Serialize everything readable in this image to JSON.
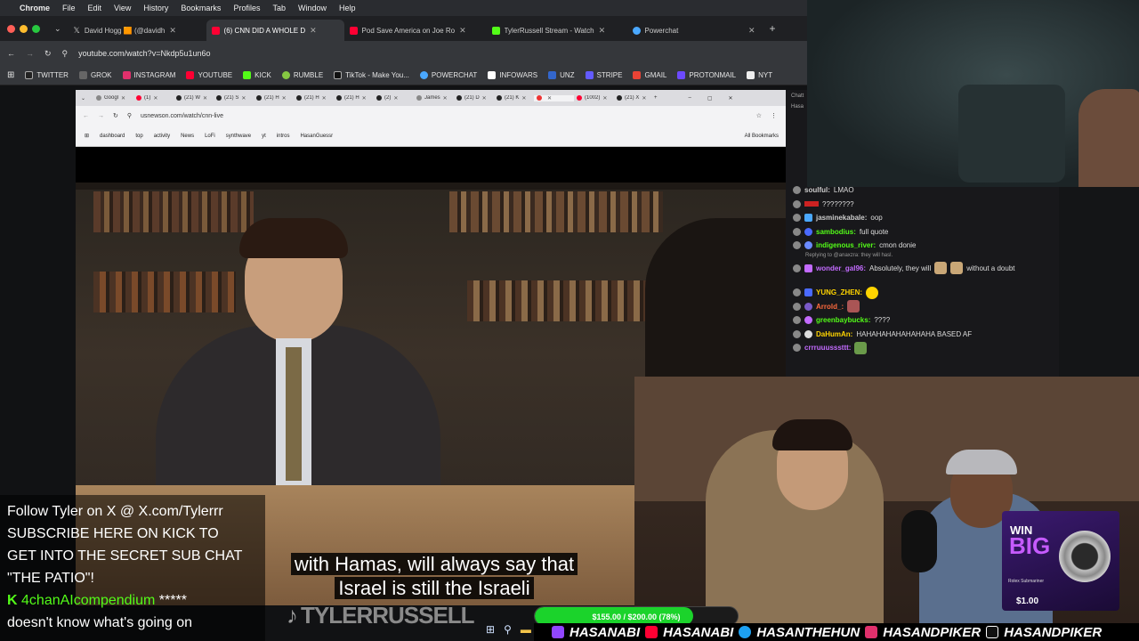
{
  "menubar": {
    "app": "Chrome",
    "items": [
      "File",
      "Edit",
      "View",
      "History",
      "Bookmarks",
      "Profiles",
      "Tab",
      "Window",
      "Help"
    ]
  },
  "browser": {
    "tabs": [
      {
        "label": "David Hogg 🟧 (@davidh",
        "color": "#ffffff"
      },
      {
        "label": "(6) CNN DID A WHOLE D",
        "color": "#ff0033"
      },
      {
        "label": "Pod Save America on Joe Ro",
        "color": "#ff0033"
      },
      {
        "label": "TylerRussell Stream - Watch",
        "color": "#53fc18"
      },
      {
        "label": "Powerchat",
        "color": "#4aa8ff"
      }
    ],
    "url": "youtube.com/watch?v=Nkdp5u1un6o",
    "bookmarks": [
      {
        "label": "TWITTER",
        "color": "#ffffff"
      },
      {
        "label": "GROK",
        "color": "#dddddd"
      },
      {
        "label": "INSTAGRAM",
        "color": "#e1306c"
      },
      {
        "label": "YOUTUBE",
        "color": "#ff0033"
      },
      {
        "label": "KICK",
        "color": "#53fc18"
      },
      {
        "label": "RUMBLE",
        "color": "#85c742"
      },
      {
        "label": "TikTok - Make You...",
        "color": "#ffffff"
      },
      {
        "label": "POWERCHAT",
        "color": "#4aa8ff"
      },
      {
        "label": "INFOWARS",
        "color": "#ffffff"
      },
      {
        "label": "UNZ",
        "color": "#3366cc"
      },
      {
        "label": "STRIPE",
        "color": "#635bff"
      },
      {
        "label": "GMAIL",
        "color": "#ea4335"
      },
      {
        "label": "PROTONMAIL",
        "color": "#6d4aff"
      },
      {
        "label": "NYT",
        "color": "#ffffff"
      }
    ]
  },
  "inner_browser": {
    "tabs": [
      "Googl",
      "(1)",
      "(21) W",
      "(21) S",
      "(21) H",
      "(21) H",
      "(21) H",
      "(2)",
      "James",
      "(21) D",
      "(21) K",
      "",
      "(1002)",
      "(21) X"
    ],
    "url": "usnewson.com/watch/cnn-live",
    "bookmarks": [
      "dashboard",
      "top",
      "activity",
      "News",
      "LoFi",
      "synthwave",
      "yt",
      "intros",
      "HasanGuessr"
    ],
    "all_bookmarks": "All Bookmarks"
  },
  "chat": {
    "header": "Chatt",
    "subheader": "Hasa",
    "messages": [
      {
        "user": "soulful:",
        "text": "LMAO",
        "color": "#cccccc"
      },
      {
        "user": "",
        "text": "????????",
        "color": "#ff4444"
      },
      {
        "user": "jasminekabale:",
        "text": "oop",
        "color": "#cccccc"
      },
      {
        "user": "sambodius:",
        "text": "full quote",
        "color": "#53fc18"
      },
      {
        "user": "indigenous_river:",
        "text": "cmon donie",
        "color": "#53fc18"
      }
    ],
    "reply_note": "Replying to @anaxzra: they will hasl.",
    "messages2": [
      {
        "user": "wonder_gal96:",
        "text": "Absolutely, they will",
        "text2": "without a doubt",
        "color": "#c36bff"
      },
      {
        "user": "YUNG_ZHEN:",
        "text": "",
        "color": "#ffd400"
      },
      {
        "user": "Arrold_:",
        "text": "",
        "color": "#ff6a3d"
      },
      {
        "user": "greenbaybucks:",
        "text": "????",
        "color": "#53fc18"
      },
      {
        "user": "DaHumAn:",
        "text": "HAHAHAHAHAHAHAHA BASED AF",
        "color": "#ffd400"
      },
      {
        "user": "crrruuusssttt:",
        "text": "",
        "color": "#c36bff"
      }
    ]
  },
  "overlay": {
    "line1": "Follow Tyler on X @ X.com/Tylerrr",
    "line2": "SUBSCRIBE HERE ON KICK TO",
    "line3": "GET INTO THE SECRET SUB CHAT",
    "line4": "\"THE PATIO\"!",
    "user": "4chanAIcompendium",
    "stars": "*****",
    "line6": "doesn't know what's going on"
  },
  "subtitles": {
    "line1": "with Hamas, will always say that",
    "line2": "Israel is still the Israeli"
  },
  "watermark": "TYLERRUSSELL",
  "goal": {
    "label": "$155.00 / $200.00 (78%)",
    "progress": 0.78,
    "color": "#1bd32b"
  },
  "socials": [
    "HASANABI",
    "HASANABI",
    "HASANTHEHUN",
    "HASANDPIKER",
    "HASANDPIKER"
  ],
  "ad": {
    "line1": "WIN",
    "line2": "BIG",
    "product": "Rolex Submariner",
    "price": "$1.00"
  }
}
